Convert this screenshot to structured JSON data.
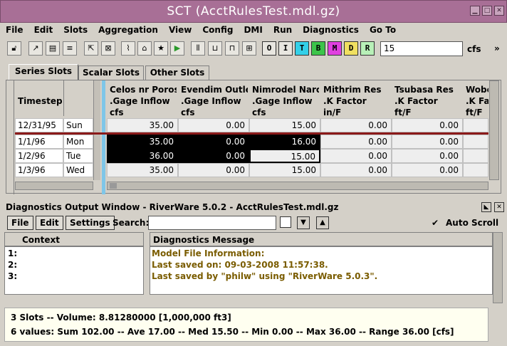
{
  "window": {
    "title": "SCT  (AcctRulesTest.mdl.gz)"
  },
  "menu": [
    "File",
    "Edit",
    "Slots",
    "Aggregation",
    "View",
    "Config",
    "DMI",
    "Run",
    "Diagnostics",
    "Go To"
  ],
  "toolbar": {
    "letters": [
      "O",
      "I",
      "T",
      "B",
      "M",
      "D",
      "R"
    ],
    "letter_colors": [
      "#ffffff",
      "#ffffff",
      "#33d0e8",
      "#3cc44a",
      "#e040e0",
      "#f0e060",
      "#b8f0b8"
    ],
    "value": "15",
    "units": "cfs",
    "more": "»"
  },
  "tabs": [
    "Series Slots",
    "Scalar Slots",
    "Other Slots"
  ],
  "table": {
    "timestep_header": "Timestep",
    "columns": [
      {
        "l1": "Celos nr Poros",
        "l2": ".Gage Inflow",
        "l3": "cfs"
      },
      {
        "l1": "Evendim Outlet",
        "l2": ".Gage Inflow",
        "l3": "cfs"
      },
      {
        "l1": "Nimrodel Narog",
        "l2": ".Gage Inflow",
        "l3": "cfs"
      },
      {
        "l1": "Mithrim Res",
        "l2": ".K Factor",
        "l3": "in/F"
      },
      {
        "l1": "Tsubasa Res",
        "l2": ".K Factor",
        "l3": "ft/F"
      },
      {
        "l1": "Wobe",
        "l2": ".K Fa",
        "l3": "ft/F"
      }
    ],
    "rows": [
      {
        "date": "12/31/95",
        "day": "Sun",
        "values": [
          "35.00",
          "0.00",
          "15.00",
          "0.00",
          "0.00",
          ""
        ]
      },
      {
        "date": "1/1/96",
        "day": "Mon",
        "values": [
          "35.00",
          "0.00",
          "16.00",
          "0.00",
          "0.00",
          ""
        ]
      },
      {
        "date": "1/2/96",
        "day": "Tue",
        "values": [
          "36.00",
          "0.00",
          "15.00",
          "0.00",
          "0.00",
          ""
        ]
      },
      {
        "date": "1/3/96",
        "day": "Wed",
        "values": [
          "35.00",
          "0.00",
          "15.00",
          "0.00",
          "0.00",
          ""
        ]
      }
    ]
  },
  "diagnostics": {
    "title": "Diagnostics Output Window - RiverWare 5.0.2 - AcctRulesTest.mdl.gz",
    "buttons": [
      "File",
      "Edit",
      "Settings"
    ],
    "search_label": "Search:",
    "auto_scroll_label": "Auto Scroll",
    "auto_scroll_checked": true,
    "context_header": "Context",
    "message_header": "Diagnostics Message",
    "context_lines": [
      "1:",
      "2:",
      "3:"
    ],
    "messages": [
      "Model File Information:",
      "Last saved on: 09-03-2008 11:57:38.",
      "Last saved by \"philw\" using \"RiverWare 5.0.3\"."
    ]
  },
  "status": {
    "line1": "3 Slots -- Volume: 8.81280000 [1,000,000 ft3]",
    "line2": "6 values:  Sum 102.00 -- Ave 17.00 -- Med 15.50 -- Min 0.00 -- Max 36.00 -- Range 36.00 [cfs]"
  }
}
